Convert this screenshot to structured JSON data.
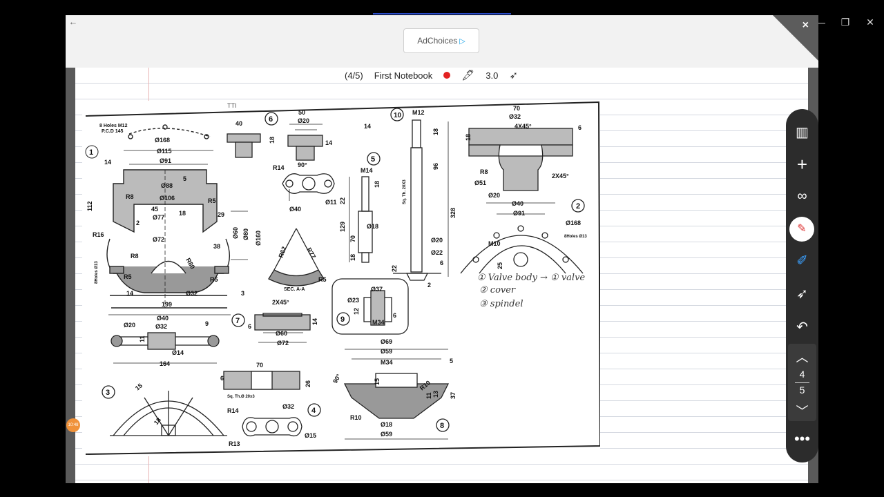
{
  "window": {
    "back_icon": "arrow-left-icon",
    "minimize": "—",
    "restore": "❐",
    "close": "✕"
  },
  "ad": {
    "label": "AdChoices",
    "choices_icon": "adchoices-triangle-icon",
    "close": "×"
  },
  "status": {
    "page_counter": "(4/5)",
    "notebook_name": "First Notebook",
    "pen_size": "3.0",
    "record_color": "#e32222"
  },
  "drawing": {
    "top_scribble": "TTI",
    "labels": {
      "holes": "8 Holes M12",
      "pcd1": "P.C.D 145",
      "d168": "Ø168",
      "d115": "Ø115",
      "d91": "Ø91",
      "d88": "Ø88",
      "d106": "Ø106",
      "d77": "Ø77",
      "d72": "Ø72",
      "d60": "Ø60",
      "d160": "Ø160",
      "r5": "R5",
      "r8": "R8",
      "r16": "R16",
      "r80": "R80",
      "n14": "14",
      "n112": "112",
      "n45": "45",
      "n18": "18",
      "n29": "29",
      "n38": "38",
      "n80": "Ø80",
      "n199": "199",
      "d32": "Ø32",
      "n3": "3",
      "n5": "5",
      "n2": "2",
      "holes2": "8Holes Ø13",
      "pcd2": "P.C.D 140",
      "c1": "1",
      "c2": "2",
      "c3": "3",
      "c4": "4",
      "c5": "5",
      "c6": "6",
      "c7": "7",
      "c8": "8",
      "c9": "9",
      "c10": "10",
      "n40": "40",
      "n50": "50",
      "d20": "Ø20",
      "n14b": "14",
      "a90": "90°",
      "r14": "R14",
      "d40": "Ø40",
      "d11": "Ø11",
      "r62": "R62",
      "r77": "R77",
      "seca": "SEC. A-A",
      "m12": "M12",
      "m14": "M14",
      "sq1": "Sq. Th. 20X3",
      "n96": "96",
      "n328": "328",
      "n129": "129",
      "n22": "22",
      "n70": "70",
      "d18": "Ø18",
      "d22": "Ø22",
      "n70b": "70",
      "d32b": "Ø32",
      "c45": "4X45°",
      "c245": "2X45°",
      "r8b": "R8",
      "d51": "Ø51",
      "d20b": "Ø20",
      "d40b": "Ø40",
      "d91b": "Ø91",
      "m10": "M10",
      "d168b": "Ø168",
      "holes3": "8Holes Ø13",
      "d37": "Ø37",
      "d23": "Ø23",
      "m34": "M34",
      "n12": "12",
      "n6": "6",
      "d40c": "Ø40",
      "d32c": "Ø32",
      "d20c": "Ø20",
      "n9": "9",
      "d14": "Ø14",
      "n164": "164",
      "d60b": "Ø60",
      "d72b": "Ø72",
      "n70c": "70",
      "sq2": "Sq. Th.Ø 20x3",
      "n26": "26",
      "r14b": "R14",
      "d32d": "Ø32",
      "d15": "Ø15",
      "r13": "R13",
      "d69": "Ø69",
      "d59": "Ø59",
      "m34b": "M34",
      "n15": "15",
      "r10": "R10",
      "n13": "13",
      "n11": "11",
      "n37": "37",
      "d18b": "Ø18",
      "d59b": "Ø59",
      "n5b": "5",
      "a90b": "90°",
      "n15b": "15",
      "n18b": "18",
      "n25": "25"
    },
    "handwritten": {
      "line1": "① Valve body → ① valve",
      "line2": "② cover",
      "line3": "③ spindel"
    }
  },
  "stamp": "10:48",
  "toolbar": {
    "library_icon": "library-icon",
    "add_icon": "plus-icon",
    "glasses_icon": "glasses-icon",
    "pen_icon": "pen-icon",
    "highlighter_icon": "highlighter-icon",
    "laser_icon": "laser-pointer-icon",
    "undo_icon": "undo-icon",
    "page_current": "4",
    "page_total": "5",
    "more_icon": "more-icon"
  }
}
